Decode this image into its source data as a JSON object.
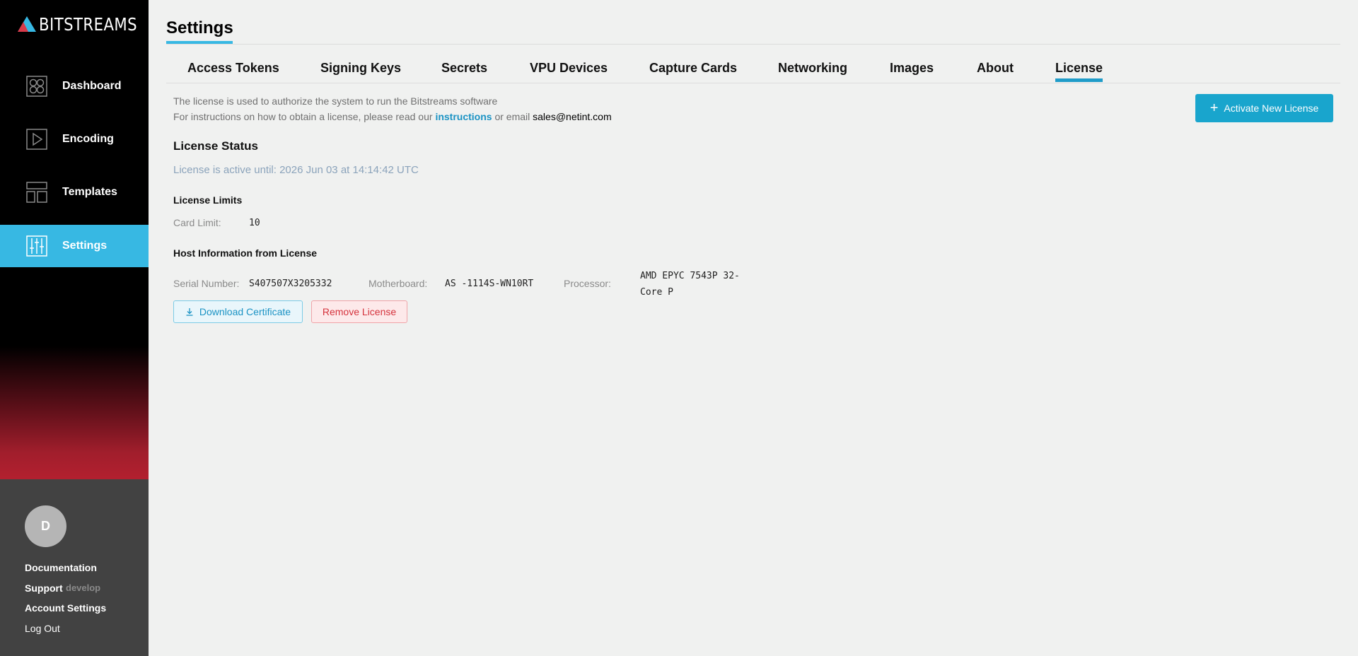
{
  "brand": {
    "name": "BITSTREAMS"
  },
  "sidebar": {
    "items": [
      {
        "label": "Dashboard",
        "icon": "dashboard-icon"
      },
      {
        "label": "Encoding",
        "icon": "play-icon"
      },
      {
        "label": "Templates",
        "icon": "layout-icon"
      },
      {
        "label": "Settings",
        "icon": "sliders-icon",
        "active": true
      }
    ],
    "user": {
      "avatar_initial": "D"
    },
    "links": {
      "documentation": "Documentation",
      "support": "Support",
      "env": "develop",
      "account_settings": "Account Settings",
      "logout": "Log Out"
    }
  },
  "page": {
    "title": "Settings"
  },
  "tabs": [
    {
      "label": "Access Tokens"
    },
    {
      "label": "Signing Keys"
    },
    {
      "label": "Secrets"
    },
    {
      "label": "VPU Devices"
    },
    {
      "label": "Capture Cards"
    },
    {
      "label": "Networking"
    },
    {
      "label": "Images"
    },
    {
      "label": "About"
    },
    {
      "label": "License",
      "active": true
    }
  ],
  "license": {
    "desc_line1": "The license is used to authorize the system to run the Bitstreams software",
    "desc_line2_prefix": "For instructions on how to obtain a license, please read our ",
    "desc_link": "instructions",
    "desc_mid": " or email ",
    "desc_email": "sales@netint.com",
    "activate_button": "Activate New License",
    "status_title": "License Status",
    "status_text": "License is active until: 2026 Jun 03 at 14:14:42 UTC",
    "limits_title": "License Limits",
    "card_limit_label": "Card Limit:",
    "card_limit_value": "10",
    "host_title": "Host Information from License",
    "serial_label": "Serial Number:",
    "serial_value": "S407507X3205332",
    "motherboard_label": "Motherboard:",
    "motherboard_value": "AS -1114S-WN10RT",
    "processor_label": "Processor:",
    "processor_value_line1": "AMD EPYC 7543P 32-",
    "processor_value_line2": "Core P",
    "download_button": "Download Certificate",
    "remove_button": "Remove License"
  },
  "colors": {
    "accent": "#37b8e3",
    "primary_button": "#19a5cd",
    "danger": "#d5333d",
    "sidebar_bg": "#000000",
    "sidebar_bottom_bg": "#424242"
  }
}
